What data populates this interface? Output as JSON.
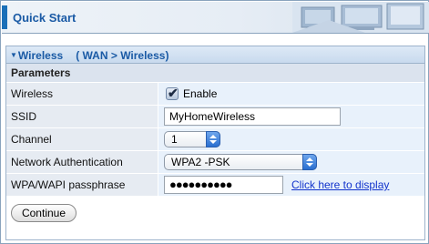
{
  "header": {
    "title": "Quick Start"
  },
  "section": {
    "title": "Wireless",
    "breadcrumb": "( WAN >  Wireless)"
  },
  "params": {
    "title": "Parameters",
    "rows": {
      "wireless": {
        "label": "Wireless",
        "checked": true,
        "option_label": "Enable"
      },
      "ssid": {
        "label": "SSID",
        "value": "MyHomeWireless"
      },
      "channel": {
        "label": "Channel",
        "value": "1"
      },
      "auth": {
        "label": "Network Authentication",
        "value": "WPA2 -PSK"
      },
      "passphrase": {
        "label": "WPA/WAPI passphrase",
        "value": "●●●●●●●●●●",
        "link": "Click here to display"
      }
    }
  },
  "actions": {
    "continue_label": "Continue"
  },
  "colors": {
    "accent": "#1a6fb8",
    "title": "#1a5aa5",
    "link": "#1133cc"
  },
  "icons": {
    "section_toggle": "triangle-down-icon",
    "check": "checkmark-icon"
  }
}
